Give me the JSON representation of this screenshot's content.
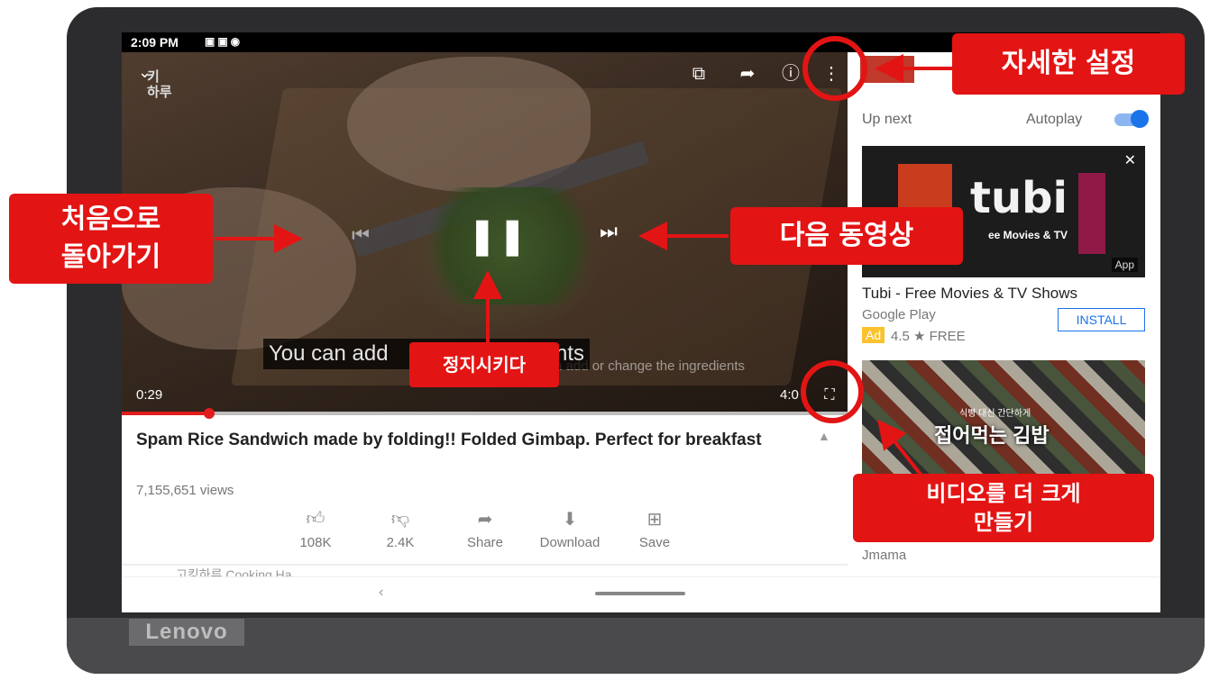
{
  "device": {
    "brand": "Lenovo"
  },
  "status_bar": {
    "time": "2:09 PM"
  },
  "player": {
    "current_time": "0:29",
    "total_time": "4:0",
    "progress_fraction": 0.12,
    "subtitle": "You can add            e ingredients",
    "subtitle_ghost": "n add or change the ingredients",
    "channel_logo": "키\n하루"
  },
  "video_info": {
    "title": "Spam Rice Sandwich made by folding!! Folded Gimbap. Perfect for breakfast",
    "views": "7,155,651 views",
    "actions": [
      {
        "icon": "thumbs-up-icon",
        "label": "108K"
      },
      {
        "icon": "thumbs-down-icon",
        "label": "2.4K"
      },
      {
        "icon": "share-icon",
        "label": "Share"
      },
      {
        "icon": "download-icon",
        "label": "Download"
      },
      {
        "icon": "save-icon",
        "label": "Save"
      }
    ],
    "next_row_text": "고킹하루 Cooking Ha"
  },
  "sidebar": {
    "up_next": "Up next",
    "autoplay": "Autoplay",
    "ad": {
      "brand_word": "tubi",
      "tagline": "ee Movies & TV",
      "app_badge": "App",
      "title": "Tubi - Free Movies & TV Shows",
      "source": "Google Play",
      "install_label": "INSTALL",
      "ad_badge": "Ad",
      "rating": "4.5 ★ FREE"
    },
    "related": {
      "thumb_text": "접어먹는 김밥",
      "thumb_small": "식빵 대신 간단하게",
      "author": "Jmama"
    }
  },
  "annotations": {
    "settings": "자세한 설정",
    "restart": "처음으로\n돌아가기",
    "next_video": "다음 동영상",
    "pause": "정지시키다",
    "fullscreen": "비디오를 더 크게\n만들기"
  },
  "colors": {
    "annotation_red": "#e31414",
    "youtube_red": "#e21c1c",
    "link_blue": "#1a73e8",
    "ad_yellow": "#f9c22e"
  }
}
